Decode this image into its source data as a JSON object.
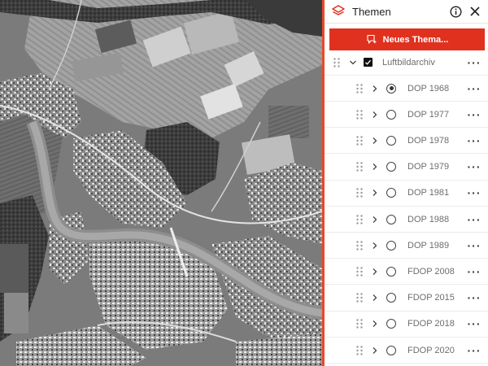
{
  "panel": {
    "title": "Themen",
    "new_theme_label": "Neues Thema...",
    "group": {
      "label": "Luftbildarchiv",
      "checked": true
    },
    "layers": [
      {
        "label": "DOP 1968",
        "selected": true
      },
      {
        "label": "DOP 1977",
        "selected": false
      },
      {
        "label": "DOP 1978",
        "selected": false
      },
      {
        "label": "DOP 1979",
        "selected": false
      },
      {
        "label": "DOP 1981",
        "selected": false
      },
      {
        "label": "DOP 1988",
        "selected": false
      },
      {
        "label": "DOP 1989",
        "selected": false
      },
      {
        "label": "FDOP 2008",
        "selected": false
      },
      {
        "label": "FDOP 2015",
        "selected": false
      },
      {
        "label": "FDOP 2018",
        "selected": false
      },
      {
        "label": "FDOP 2020",
        "selected": false
      }
    ]
  },
  "icons": {
    "layers": "layers-icon",
    "info": "info-icon",
    "close": "close-icon",
    "new_theme": "add-theme-icon",
    "grip": "drag-handle-icon",
    "expand": "chevron-right-icon",
    "collapse": "chevron-down-icon",
    "more": "more-icon"
  },
  "colors": {
    "accent": "#e0311f",
    "panel_border": "#e8492c"
  }
}
